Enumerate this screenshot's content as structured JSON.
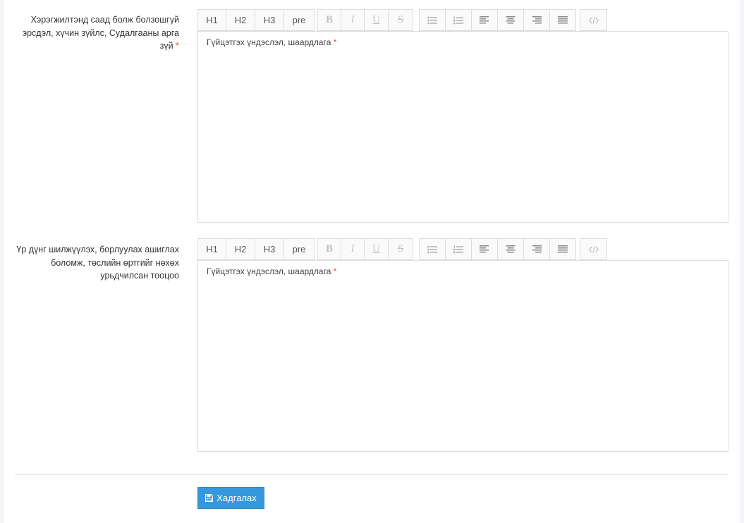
{
  "fields": [
    {
      "label_lines": [
        "Хэрэгжилтэнд саад болж болзошгүй",
        "эрсдэл, хүчин зүйлс, Судалгааны арга",
        "зүй"
      ],
      "required_marker": "*",
      "placeholder_text": "Гүйцэтгэх үндэслэл, шаардлага",
      "placeholder_required": "*"
    },
    {
      "label_lines": [
        "Үр дүнг шилжүүлэх, борлуулах ашиглах",
        "боломж, төслийн өртгийг нөхөх",
        "урьдчилсан тооцоо"
      ],
      "required_marker": "",
      "placeholder_text": "Гүйцэтгэх үндэслэл, шаардлага",
      "placeholder_required": "*"
    }
  ],
  "toolbar": {
    "h1": "H1",
    "h2": "H2",
    "h3": "H3",
    "pre": "pre",
    "bold": "B",
    "italic": "I",
    "underline": "U",
    "strike": "S"
  },
  "actions": {
    "save_label": "Хадгалах",
    "save_icon": "floppy-disk-icon"
  },
  "colors": {
    "primary_button": "#3598dc",
    "required": "#e84c3d"
  }
}
